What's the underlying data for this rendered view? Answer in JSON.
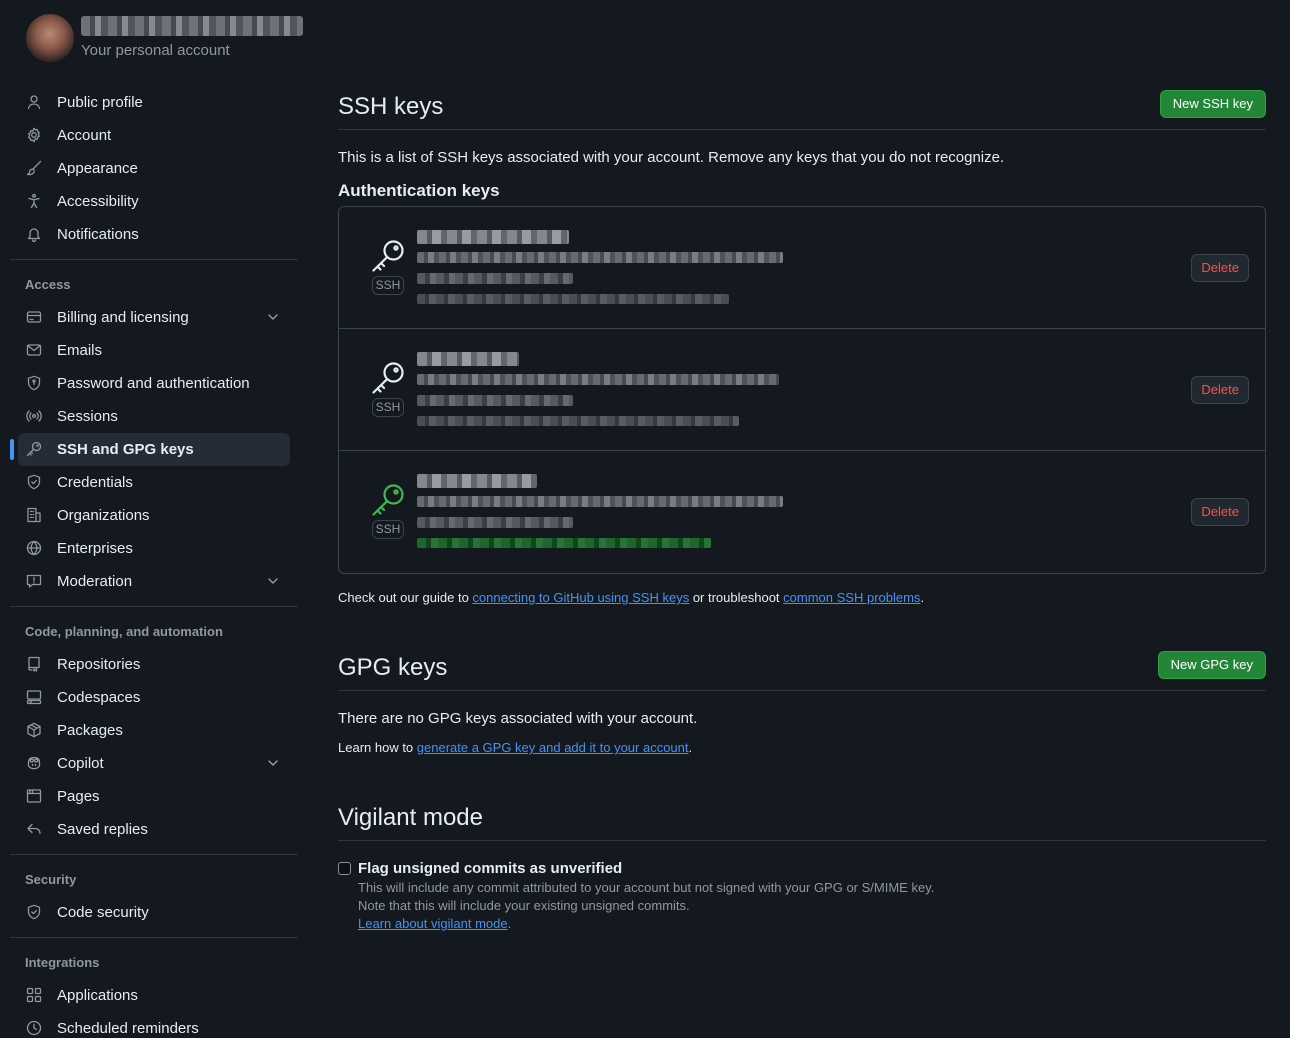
{
  "account": {
    "subtitle": "Your personal account"
  },
  "sidebar": {
    "items_top": [
      {
        "label": "Public profile",
        "icon": "person-icon"
      },
      {
        "label": "Account",
        "icon": "gear-icon"
      },
      {
        "label": "Appearance",
        "icon": "paintbrush-icon"
      },
      {
        "label": "Accessibility",
        "icon": "accessibility-icon"
      },
      {
        "label": "Notifications",
        "icon": "bell-icon"
      }
    ],
    "access_heading": "Access",
    "access_items": [
      {
        "label": "Billing and licensing",
        "icon": "credit-card-icon",
        "expandable": true
      },
      {
        "label": "Emails",
        "icon": "mail-icon"
      },
      {
        "label": "Password and authentication",
        "icon": "shield-lock-icon"
      },
      {
        "label": "Sessions",
        "icon": "broadcast-icon"
      },
      {
        "label": "SSH and GPG keys",
        "icon": "key-icon",
        "active": true
      },
      {
        "label": "Credentials",
        "icon": "shield-check-icon"
      },
      {
        "label": "Organizations",
        "icon": "organization-icon"
      },
      {
        "label": "Enterprises",
        "icon": "globe-icon"
      },
      {
        "label": "Moderation",
        "icon": "report-icon",
        "expandable": true
      }
    ],
    "code_heading": "Code, planning, and automation",
    "code_items": [
      {
        "label": "Repositories",
        "icon": "repo-icon"
      },
      {
        "label": "Codespaces",
        "icon": "codespaces-icon"
      },
      {
        "label": "Packages",
        "icon": "package-icon"
      },
      {
        "label": "Copilot",
        "icon": "copilot-icon",
        "expandable": true
      },
      {
        "label": "Pages",
        "icon": "browser-icon"
      },
      {
        "label": "Saved replies",
        "icon": "reply-icon"
      }
    ],
    "security_heading": "Security",
    "security_items": [
      {
        "label": "Code security",
        "icon": "shield-check-icon"
      }
    ],
    "integrations_heading": "Integrations",
    "integrations_items": [
      {
        "label": "Applications",
        "icon": "apps-icon"
      },
      {
        "label": "Scheduled reminders",
        "icon": "clock-icon"
      }
    ]
  },
  "ssh": {
    "title": "SSH keys",
    "new_button": "New SSH key",
    "description": "This is a list of SSH keys associated with your account. Remove any keys that you do not recognize.",
    "auth_heading": "Authentication keys",
    "keys": [
      {
        "badge": "SSH",
        "delete_label": "Delete",
        "recently_used": false
      },
      {
        "badge": "SSH",
        "delete_label": "Delete",
        "recently_used": false
      },
      {
        "badge": "SSH",
        "delete_label": "Delete",
        "recently_used": true
      }
    ],
    "guide_prefix": "Check out our guide to ",
    "guide_link": "connecting to GitHub using SSH keys",
    "guide_middle": " or troubleshoot ",
    "troubleshoot_link": "common SSH problems",
    "guide_suffix": "."
  },
  "gpg": {
    "title": "GPG keys",
    "new_button": "New GPG key",
    "empty_text": "There are no GPG keys associated with your account.",
    "learn_prefix": "Learn how to ",
    "learn_link": "generate a GPG key and add it to your account",
    "learn_suffix": "."
  },
  "vigilant": {
    "title": "Vigilant mode",
    "checkbox_label": "Flag unsigned commits as unverified",
    "checked": false,
    "note_line1": "This will include any commit attributed to your account but not signed with your GPG or S/MIME key.",
    "note_line2": "Note that this will include your existing unsigned commits.",
    "learn_link": "Learn about vigilant mode",
    "learn_suffix": "."
  },
  "colors": {
    "background": "#14181f",
    "accent_blue": "#4493f8",
    "button_green": "#238636",
    "danger_red": "#f85149",
    "verified_green": "#3fb950"
  }
}
